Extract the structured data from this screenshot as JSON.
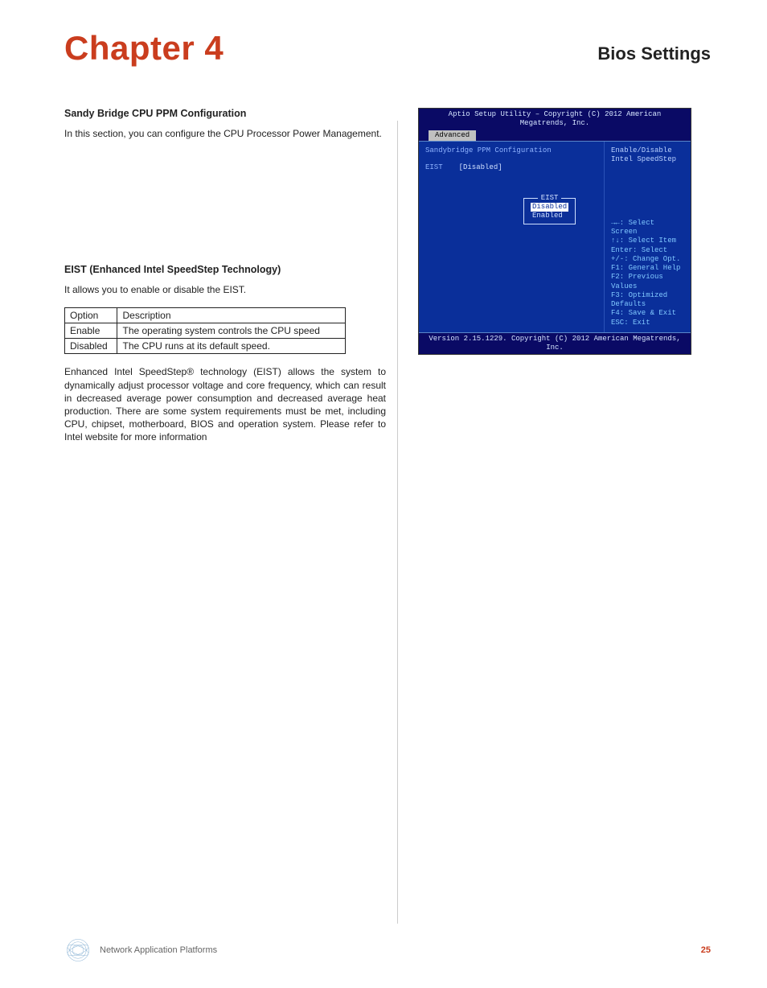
{
  "header": {
    "chapter": "Chapter 4",
    "section": "Bios Settings"
  },
  "left": {
    "h1": "Sandy Bridge CPU PPM Configuration",
    "p1": "In this section, you can configure the CPU Processor Power Management.",
    "h2": "EIST (Enhanced Intel SpeedStep Technology)",
    "p2": "It allows you to enable or disable the EIST.",
    "table": {
      "head": {
        "c1": "Option",
        "c2": "Description"
      },
      "rows": [
        {
          "c1": "Enable",
          "c2": "The operating system controls the CPU speed"
        },
        {
          "c1": "Disabled",
          "c2": "The CPU runs at its default speed."
        }
      ]
    },
    "p3": "Enhanced Intel SpeedStep® technology (EIST) allows the system to dynamically adjust processor voltage and core frequency, which can result in decreased average power consumption and decreased average heat production. There are some system requirements must be met, including CPU, chipset, motherboard, BIOS and operation system. Please refer to Intel website for more information"
  },
  "bios": {
    "title": "Aptio Setup Utility – Copyright (C) 2012 American Megatrends, Inc.",
    "tab": "Advanced",
    "section": "Sandybridge PPM Configuration",
    "item": {
      "label": "EIST",
      "value": "[Disabled]"
    },
    "popup": {
      "title": "EIST",
      "options": [
        "Disabled",
        "Enabled"
      ],
      "selected": "Disabled"
    },
    "help_top": "Enable/Disable Intel SpeedStep",
    "help": [
      "→←: Select Screen",
      "↑↓: Select Item",
      "Enter: Select",
      "+/-: Change Opt.",
      "F1: General Help",
      "F2: Previous Values",
      "F3: Optimized Defaults",
      "F4: Save & Exit",
      "ESC: Exit"
    ],
    "footer": "Version 2.15.1229. Copyright (C) 2012 American Megatrends, Inc."
  },
  "footer": {
    "text": "Network Application Platforms",
    "page": "25"
  }
}
